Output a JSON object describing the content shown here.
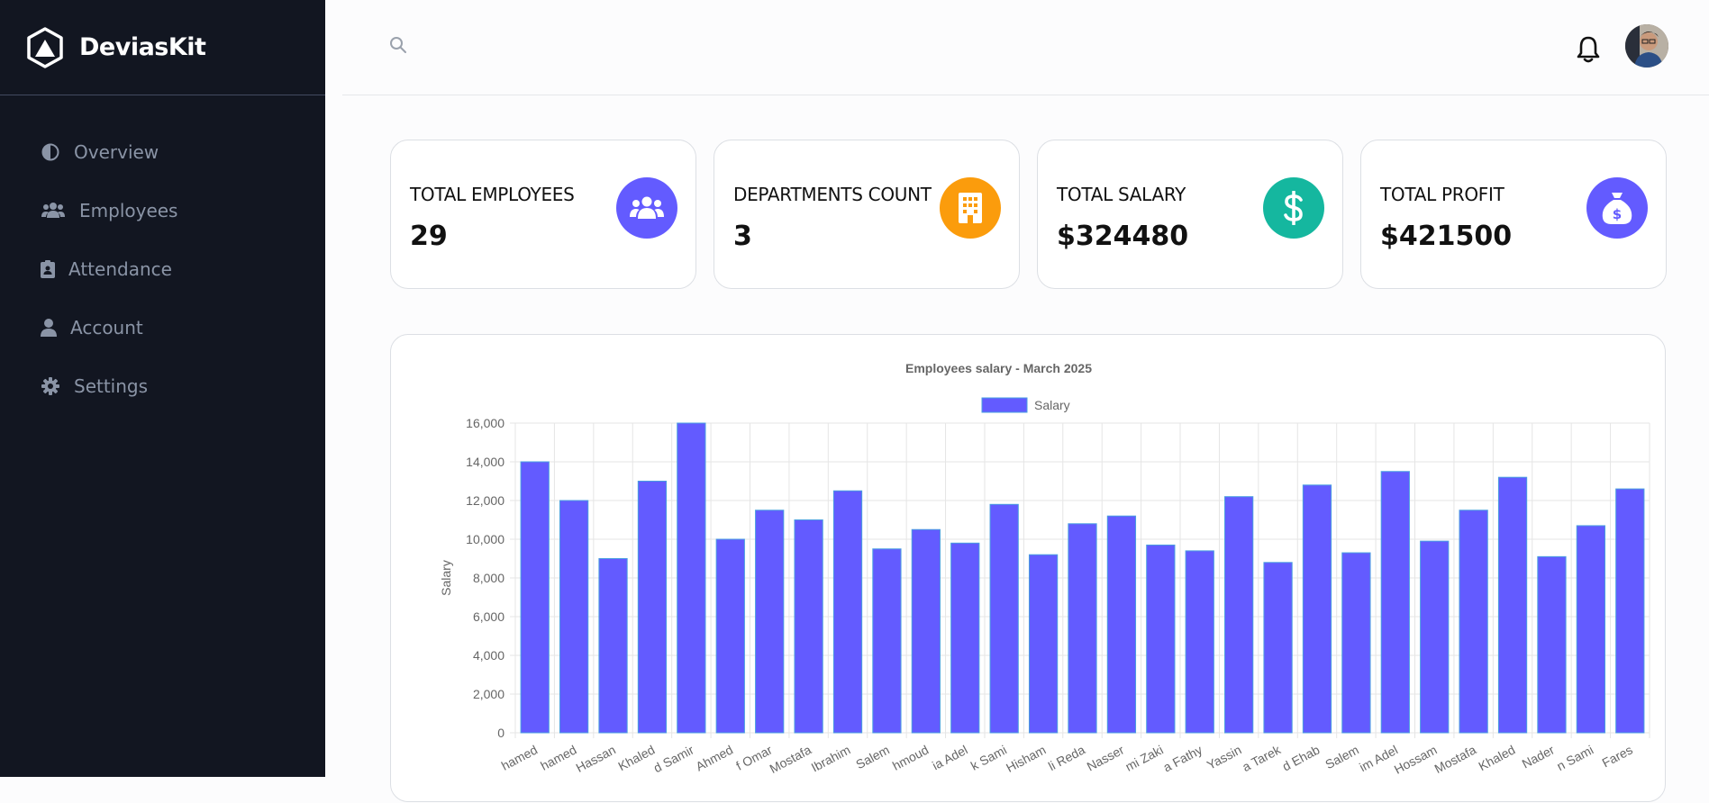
{
  "brand": {
    "name": "DeviasKit"
  },
  "nav": [
    {
      "label": "Overview",
      "icon": "half-circle-icon"
    },
    {
      "label": "Employees",
      "icon": "users-icon"
    },
    {
      "label": "Attendance",
      "icon": "clipboard-icon"
    },
    {
      "label": "Account",
      "icon": "user-icon"
    },
    {
      "label": "Settings",
      "icon": "gear-icon"
    }
  ],
  "cards": [
    {
      "label": "TOTAL EMPLOYEES",
      "value": "29",
      "color": "#635bff",
      "icon": "users-icon"
    },
    {
      "label": "DEPARTMENTS COUNT",
      "value": "3",
      "color": "#fb9c0c",
      "icon": "building-icon"
    },
    {
      "label": "TOTAL SALARY",
      "value": "$324480",
      "color": "#15b79f",
      "icon": "dollar-icon"
    },
    {
      "label": "TOTAL PROFIT",
      "value": "$421500",
      "color": "#635bff",
      "icon": "money-bag-icon"
    }
  ],
  "chart_data": {
    "type": "bar",
    "title": "Employees salary - March 2025",
    "ylabel": "Salary",
    "ylim": [
      0,
      16000
    ],
    "yticks": [
      "0",
      "2,000",
      "4,000",
      "6,000",
      "8,000",
      "10,000",
      "12,000",
      "14,000",
      "16,000"
    ],
    "grid": true,
    "legend": "top-center",
    "bar_color": "#635bff",
    "series": [
      {
        "name": "Salary"
      }
    ],
    "categories": [
      "hamed",
      "hamed",
      "Hassan",
      "Khaled",
      "d Samir",
      "Ahmed",
      "f Omar",
      "Mostafa",
      "Ibrahim",
      "Salem",
      "hmoud",
      "ia Adel",
      "k Sami",
      "Hisham",
      "li Reda",
      "Nasser",
      "mi Zaki",
      "a Fathy",
      "Yassin",
      "a Tarek",
      "d Ehab",
      "Salem",
      "im Adel",
      "Hossam",
      "Mostafa",
      "Khaled",
      "Nader",
      "n Sami",
      "Fares"
    ],
    "values": [
      14000,
      12000,
      9000,
      13000,
      16000,
      10000,
      11500,
      11000,
      12500,
      9500,
      10500,
      9800,
      11800,
      9200,
      10800,
      11200,
      9700,
      9400,
      12200,
      8800,
      12800,
      9300,
      13500,
      9900,
      11500,
      13200,
      9100,
      10700,
      12600
    ]
  }
}
